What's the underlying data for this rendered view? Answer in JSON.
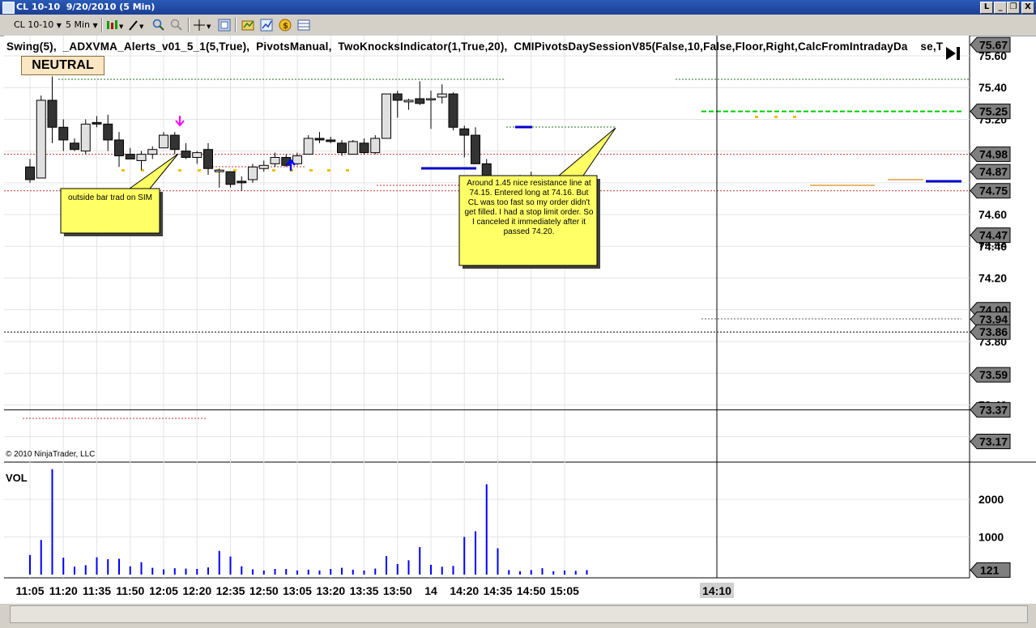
{
  "window": {
    "title": "CL 10-10  9/20/2010 (5 Min)",
    "buttons": [
      "L",
      "_",
      "❐",
      "X"
    ]
  },
  "toolbar": {
    "instrument": "CL 10-10",
    "interval": "5 Min",
    "icons": [
      "candlestick-style-icon",
      "drawing-pencil-icon",
      "zoom-in-icon",
      "zoom-out-icon",
      "crosshair-icon",
      "properties-icon",
      "strategy-icon",
      "data-box-icon",
      "order-icon",
      "grid-icon"
    ]
  },
  "chart": {
    "indicators_text": "Swing(5),  _ADXVMA_Alerts_v01_5_1(5,True),  PivotsManual,  TwoKnocksIndicator(1,True,20),  CMIPivotsDaySessionV85(False,10,False,Floor,Right,CalcFromIntradayDa    se,T",
    "status_badge": "NEUTRAL",
    "copyright": "© 2010 NinjaTrader, LLC",
    "volume_label": "VOL",
    "price_ticks": [
      "75.60",
      "75.40",
      "75.20",
      "74.60",
      "74.20",
      "73.80"
    ],
    "price_marker_labels": [
      "75.67",
      "75.25",
      "74.98",
      "74.87",
      "74.75",
      "74.47",
      "74.00",
      "73.94",
      "73.86",
      "73.59",
      "73.37",
      "73.17"
    ],
    "partially_hidden_ticks": [
      "74.42",
      "74.40",
      "73.40"
    ],
    "volume_ticks": [
      "2000",
      "1000"
    ],
    "volume_marker": "121",
    "time_labels": [
      "11:05",
      "11:20",
      "11:35",
      "11:50",
      "12:05",
      "12:20",
      "12:35",
      "12:50",
      "13:05",
      "13:20",
      "13:35",
      "13:50",
      "14",
      "14:20",
      "14:35",
      "14:50",
      "15:05"
    ],
    "cursor_time": "14:10",
    "callouts": [
      {
        "text": "outside bar trad on SIM"
      },
      {
        "text": "Around 1.45 nice resistance line at 74.15. Entered long at 74.16. But CL was too fast so my order didn't get filled. I had a stop limit order. So I canceled it immediately after it passed 74.20."
      }
    ],
    "colors": {
      "bull_candle": "#e0e0e0",
      "bear_candle": "#333333",
      "pivot_green": "#00cc00",
      "volume_bar": "#0000ff",
      "marker_bg": "#7f7f7f",
      "callout_bg": "#ffff66",
      "arrow_magenta": "#ff00ff",
      "arrow_blue": "#0000ff"
    }
  },
  "chart_data": {
    "type": "candlestick",
    "title": "CL 10-10  9/20/2010 (5 Min)",
    "ylim": [
      73.1,
      75.72
    ],
    "times": [
      "11:05",
      "11:10",
      "11:15",
      "11:20",
      "11:25",
      "11:30",
      "11:35",
      "11:40",
      "11:45",
      "11:50",
      "11:55",
      "12:00",
      "12:05",
      "12:10",
      "12:15",
      "12:20",
      "12:25",
      "12:30",
      "12:35",
      "12:40",
      "12:45",
      "12:50",
      "12:55",
      "13:00",
      "13:05",
      "13:10",
      "13:15",
      "13:20",
      "13:25",
      "13:30",
      "13:35",
      "13:40",
      "13:45",
      "13:50",
      "13:55",
      "14:00",
      "14:05",
      "14:10",
      "14:15",
      "14:20",
      "14:25",
      "14:30",
      "14:35",
      "14:40",
      "14:45",
      "14:50",
      "14:55",
      "15:00",
      "15:05",
      "15:10",
      "15:15"
    ],
    "ohlc": [
      [
        74.9,
        74.95,
        74.8,
        74.82
      ],
      [
        74.83,
        75.35,
        74.83,
        75.32
      ],
      [
        75.32,
        75.47,
        75.05,
        75.15
      ],
      [
        75.15,
        75.2,
        75.0,
        75.07
      ],
      [
        75.05,
        75.08,
        75.0,
        75.01
      ],
      [
        75.0,
        75.2,
        74.98,
        75.17
      ],
      [
        75.18,
        75.22,
        75.15,
        75.17
      ],
      [
        75.17,
        75.23,
        75.0,
        75.07
      ],
      [
        75.07,
        75.12,
        74.9,
        74.97
      ],
      [
        74.98,
        75.02,
        74.95,
        74.95
      ],
      [
        74.94,
        75.0,
        74.88,
        74.98
      ],
      [
        74.98,
        75.03,
        74.95,
        75.01
      ],
      [
        75.02,
        75.12,
        75.02,
        75.1
      ],
      [
        75.1,
        75.12,
        74.98,
        75.01
      ],
      [
        75.0,
        75.05,
        74.95,
        74.96
      ],
      [
        74.96,
        75.0,
        74.92,
        74.99
      ],
      [
        75.01,
        75.05,
        74.85,
        74.89
      ],
      [
        74.87,
        74.89,
        74.77,
        74.88
      ],
      [
        74.87,
        74.85,
        74.77,
        74.79
      ],
      [
        74.81,
        74.84,
        74.75,
        74.8
      ],
      [
        74.82,
        74.92,
        74.8,
        74.9
      ],
      [
        74.89,
        74.94,
        74.87,
        74.91
      ],
      [
        74.92,
        74.99,
        74.9,
        74.96
      ],
      [
        74.96,
        74.98,
        74.9,
        74.91
      ],
      [
        74.92,
        74.99,
        74.91,
        74.97
      ],
      [
        74.98,
        75.1,
        74.98,
        75.08
      ],
      [
        75.08,
        75.12,
        75.05,
        75.07
      ],
      [
        75.07,
        75.09,
        75.05,
        75.06
      ],
      [
        75.05,
        75.07,
        74.97,
        74.99
      ],
      [
        74.98,
        75.07,
        74.98,
        75.06
      ],
      [
        75.05,
        75.08,
        74.98,
        74.99
      ],
      [
        74.99,
        75.1,
        74.98,
        75.08
      ],
      [
        75.08,
        75.36,
        75.08,
        75.36
      ],
      [
        75.36,
        75.38,
        75.21,
        75.32
      ],
      [
        75.31,
        75.33,
        75.26,
        75.32
      ],
      [
        75.33,
        75.44,
        75.29,
        75.3
      ],
      [
        75.33,
        75.38,
        75.14,
        75.33
      ],
      [
        75.34,
        75.42,
        75.3,
        75.36
      ],
      [
        75.36,
        75.37,
        75.13,
        75.15
      ],
      [
        75.14,
        75.16,
        74.96,
        75.1
      ],
      [
        75.1,
        75.15,
        74.92,
        74.92
      ],
      [
        74.92,
        74.95,
        74.75,
        74.75
      ],
      [
        74.75,
        74.83,
        74.75,
        74.83
      ],
      [
        74.82,
        74.83,
        74.73,
        74.77
      ],
      [
        74.77,
        74.85,
        74.76,
        74.84
      ],
      [
        74.83,
        74.87,
        74.76,
        74.78
      ],
      [
        74.78,
        74.78,
        74.76,
        74.77
      ],
      [
        74.77,
        74.78,
        74.76,
        74.76
      ],
      [
        74.76,
        74.78,
        74.75,
        74.76
      ],
      [
        74.75,
        74.78,
        74.74,
        74.74
      ],
      [
        74.74,
        74.75,
        74.73,
        74.74
      ]
    ],
    "volume": [
      520,
      920,
      2800,
      450,
      210,
      250,
      460,
      410,
      420,
      220,
      330,
      180,
      140,
      170,
      160,
      150,
      190,
      630,
      480,
      220,
      140,
      110,
      150,
      150,
      110,
      130,
      110,
      150,
      180,
      130,
      110,
      160,
      490,
      280,
      380,
      730,
      260,
      210,
      230,
      1000,
      1150,
      2400,
      700,
      120,
      90,
      120,
      170,
      90,
      110,
      100,
      120
    ],
    "volume_ylim": [
      0,
      3000
    ],
    "horizontal_levels": [
      {
        "price": 75.25,
        "color": "#00cc00",
        "style": "dashed"
      },
      {
        "price": 74.98,
        "color": "#cc3333",
        "style": "dotted"
      },
      {
        "price": 74.75,
        "color": "#cc3333",
        "style": "dotted"
      },
      {
        "price": 73.86,
        "color": "#000000",
        "style": "dotted"
      },
      {
        "price": 73.37,
        "color": "#000000",
        "style": "solid"
      }
    ]
  }
}
